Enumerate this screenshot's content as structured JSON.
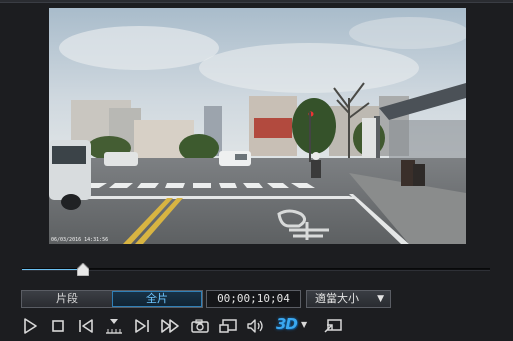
{
  "video": {
    "timestamp_overlay": "06/03/2016 14:31:56"
  },
  "seek": {
    "progress": 0.13
  },
  "modes": {
    "segment_label": "片段",
    "full_label": "全片",
    "active": "full"
  },
  "timecode": "00;00;10;04",
  "size_select": {
    "value": "適當大小",
    "arrow": "▼"
  },
  "toolbar": {
    "three_d_label": "3D",
    "three_d_arrow": "▼",
    "icons": [
      "play-icon",
      "stop-icon",
      "previous-frame-icon",
      "mark-icon",
      "next-frame-icon",
      "fast-forward-icon",
      "snapshot-icon",
      "pip-icon",
      "volume-icon",
      "3d-icon",
      "dropdown-arrow-icon",
      "external-display-icon"
    ]
  },
  "colors": {
    "accent": "#6cc0f0",
    "background": "#1c1d20",
    "three_d": "#3aa8f0"
  }
}
